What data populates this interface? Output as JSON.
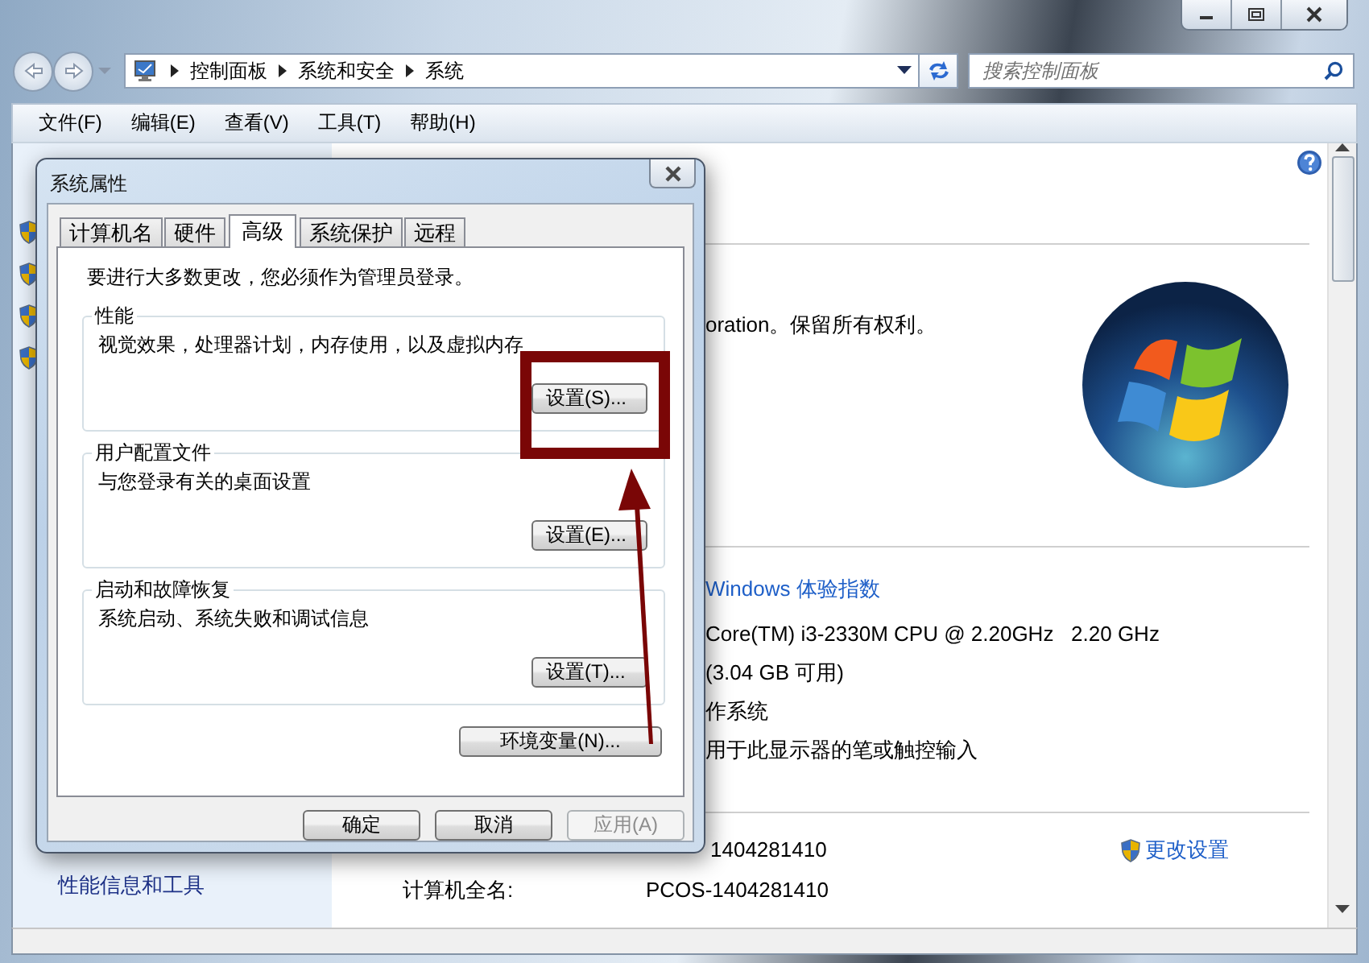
{
  "address_bar": {
    "crumbs": [
      "控制面板",
      "系统和安全",
      "系统"
    ]
  },
  "search": {
    "placeholder": "搜索控制面板"
  },
  "menu": [
    "文件(F)",
    "编辑(E)",
    "查看(V)",
    "工具(T)",
    "帮助(H)"
  ],
  "left_pane": {
    "links": [
      "性能信息和工具"
    ]
  },
  "content": {
    "copyright": "oration。保留所有权利。",
    "rating_link": "Windows 体验指数",
    "processor": "Core(TM) i3-2330M CPU @ 2.20GHz   2.20 GHz",
    "memory": "(3.04 GB 可用)",
    "system_type": "作系统",
    "pen": "用于此显示器的笔或触控输入",
    "computer_name": "1404281410",
    "change_settings": "更改设置",
    "full_name_label": "计算机全名:",
    "full_name": "PCOS-1404281410"
  },
  "dialog": {
    "title": "系统属性",
    "tabs": [
      {
        "label": "计算机名",
        "selected": false
      },
      {
        "label": "硬件",
        "selected": false
      },
      {
        "label": "高级",
        "selected": true
      },
      {
        "label": "系统保护",
        "selected": false
      },
      {
        "label": "远程",
        "selected": false
      }
    ],
    "notice": "要进行大多数更改，您必须作为管理员登录。",
    "groups": [
      {
        "title": "性能",
        "description": "视觉效果，处理器计划，内存使用，以及虚拟内存",
        "button": "设置(S)..."
      },
      {
        "title": "用户配置文件",
        "description": "与您登录有关的桌面设置",
        "button": "设置(E)..."
      },
      {
        "title": "启动和故障恢复",
        "description": "系统启动、系统失败和调试信息",
        "button": "设置(T)..."
      }
    ],
    "env_button": "环境变量(N)...",
    "buttons": [
      {
        "label": "确定",
        "disabled": false
      },
      {
        "label": "取消",
        "disabled": false
      },
      {
        "label": "应用(A)",
        "disabled": true
      }
    ]
  }
}
